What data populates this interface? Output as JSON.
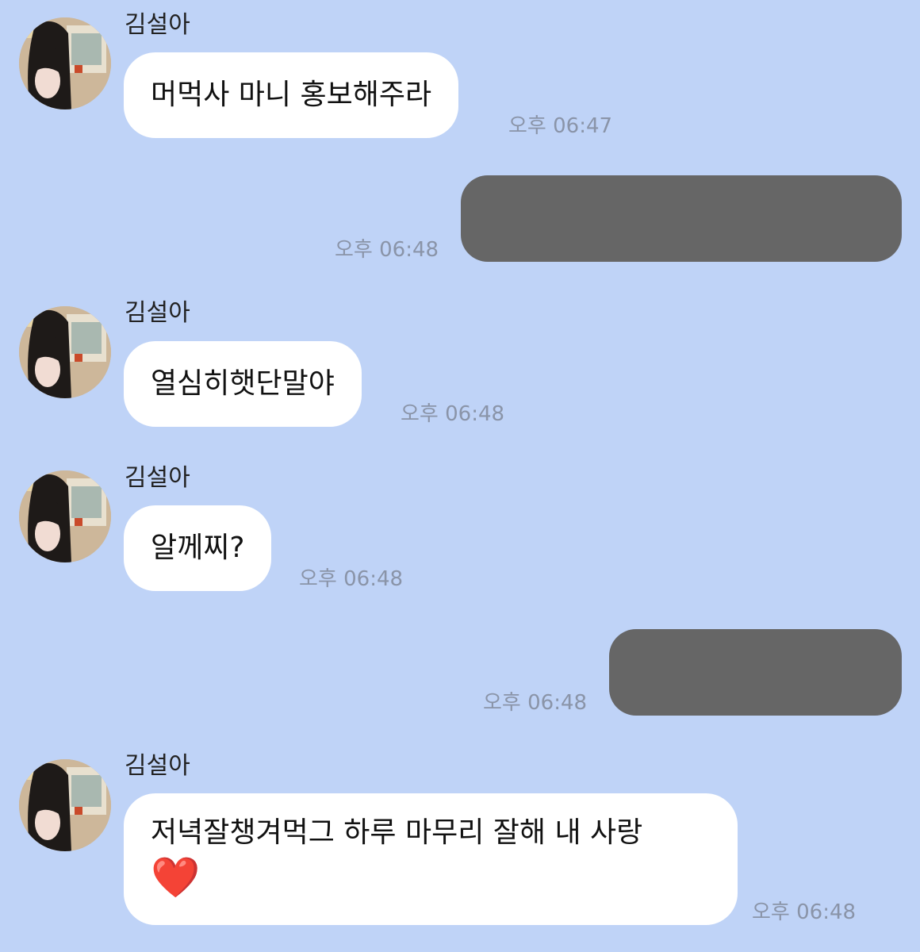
{
  "chat": {
    "sender_name": "김설아",
    "avatar_icon": "profile-photo",
    "colors": {
      "background": "#bfd3f7",
      "incoming_bubble": "#ffffff",
      "outgoing_bubble_redacted": "#666666",
      "timestamp": "#8a94a8"
    },
    "messages": [
      {
        "direction": "incoming",
        "sender": "김설아",
        "text": "머먹사 마니 홍보해주라",
        "time": "오후 06:47"
      },
      {
        "direction": "outgoing",
        "redacted": true,
        "time": "오후 06:48"
      },
      {
        "direction": "incoming",
        "sender": "김설아",
        "text": "열심히햇단말야",
        "time": "오후 06:48"
      },
      {
        "direction": "incoming",
        "sender": "김설아",
        "text": "알께찌?",
        "time": "오후 06:48"
      },
      {
        "direction": "outgoing",
        "redacted": true,
        "time": "오후 06:48"
      },
      {
        "direction": "incoming",
        "sender": "김설아",
        "text_line1": "저녁잘챙겨먹그 하루 마무리 잘해 내 사랑",
        "text_emoji": "❤️",
        "time": "오후 06:48"
      }
    ]
  }
}
